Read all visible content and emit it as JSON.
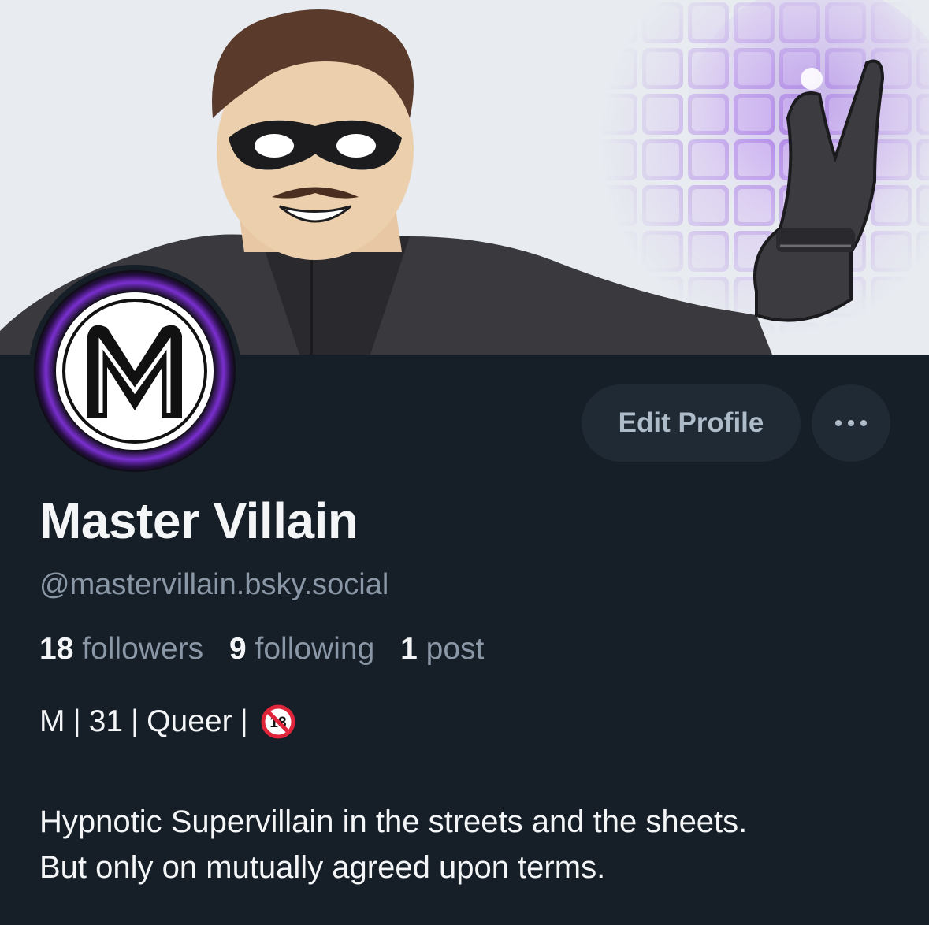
{
  "banner": {
    "alt": "profile banner illustration"
  },
  "avatar": {
    "alt": "M logo avatar"
  },
  "actions": {
    "edit_profile_label": "Edit Profile",
    "more_label": "..."
  },
  "profile": {
    "display_name": "Master Villain",
    "handle": "@mastervillain.bsky.social"
  },
  "stats": {
    "followers_count": "18",
    "followers_label": "followers",
    "following_count": "9",
    "following_label": "following",
    "posts_count": "1",
    "posts_label": "post"
  },
  "tags": {
    "gender": "M",
    "age": "31",
    "identity": "Queer",
    "separator": "|",
    "icon": "no-under-18-icon"
  },
  "bio": {
    "line1": "Hypnotic Supervillain in the streets and the sheets.",
    "line2": "But only on mutually agreed upon terms."
  },
  "colors": {
    "background": "#161e27",
    "button_bg": "#1f2a35",
    "muted_text": "#8a97a6",
    "primary_text": "#f3f5f7",
    "accent_purple": "#8b3fd6"
  }
}
